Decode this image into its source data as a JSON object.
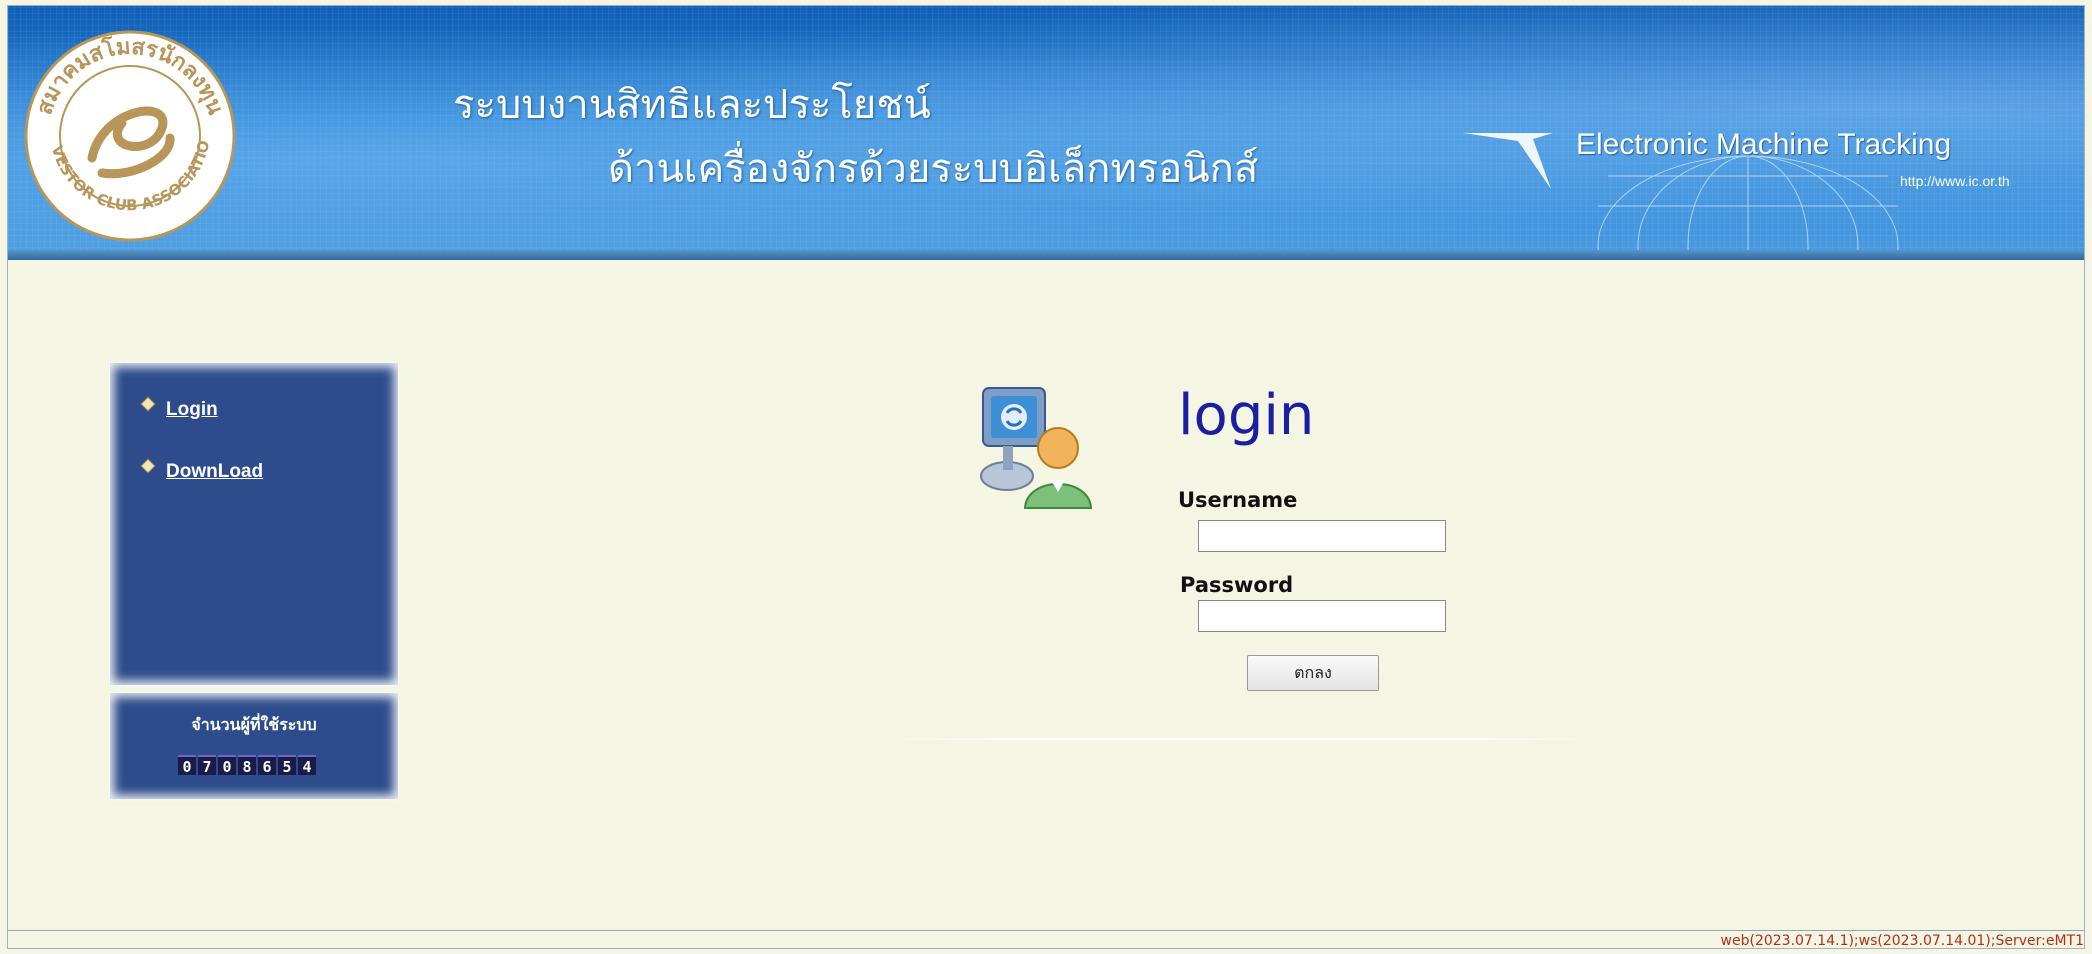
{
  "header": {
    "title_line1": "ระบบงานสิทธิและประโยชน์",
    "title_line2": "ด้านเครื่องจักรด้วยระบบอิเล็กทรอนิกส์",
    "system_name": "Electronic Machine Tracking",
    "url": "http://www.ic.or.th",
    "logo": {
      "top_text": "สมาคมสโมสรนักลงทุน",
      "bottom_text": "INVESTOR CLUB ASSOCIATION",
      "color": "#b8965a"
    }
  },
  "menu": {
    "items": [
      {
        "label": "Login"
      },
      {
        "label": "DownLoad"
      }
    ],
    "bullet_icon": "diamond-bullet-icon"
  },
  "counter": {
    "label": "จำนวนผู้ที่ใช้ระบบ",
    "digits": [
      "0",
      "7",
      "0",
      "8",
      "6",
      "5",
      "4"
    ]
  },
  "login_form": {
    "heading": "login",
    "username_label": "Username",
    "username_value": "",
    "password_label": "Password",
    "password_value": "",
    "submit_label": "ตกลง",
    "icon": "user-computer-icon"
  },
  "footer": {
    "version": "web(2023.07.14.1);ws(2023.07.14.01);Server:eMT1"
  },
  "colors": {
    "page_background": "#f5f5e3",
    "banner_blue": "#2b84d6",
    "menu_panel": "#2e4c8c",
    "heading_blue": "#1b1ea0",
    "version_text": "#b0301a"
  }
}
